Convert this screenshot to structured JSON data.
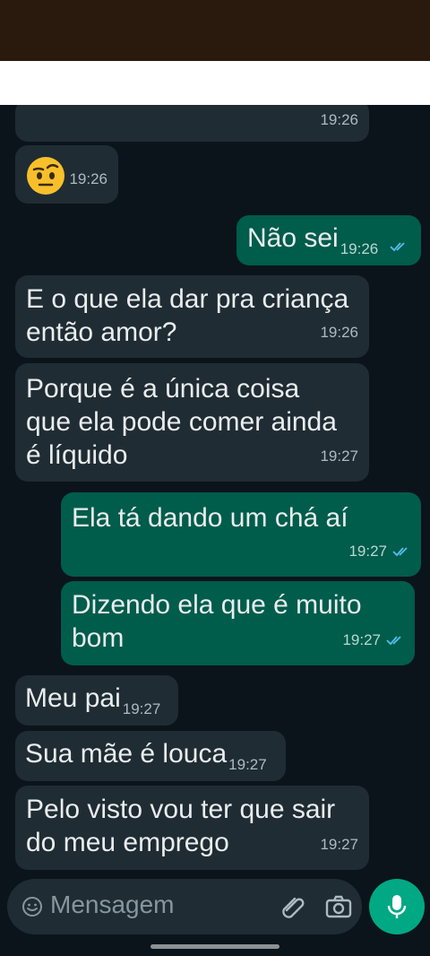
{
  "messages": [
    {
      "direction": "in",
      "text": "",
      "time": "19:26"
    },
    {
      "direction": "in",
      "emoji": "face-with-raised-eyebrow",
      "time": "19:26"
    },
    {
      "direction": "out",
      "text": "Não sei",
      "time": "19:26",
      "status": "read"
    },
    {
      "direction": "in",
      "lines": [
        "E o que ela dar pra criança",
        "então amor?"
      ],
      "time": "19:26"
    },
    {
      "direction": "in",
      "lines": [
        "Porque é a única coisa",
        "que ela pode comer ainda",
        "é líquido"
      ],
      "time": "19:27"
    },
    {
      "direction": "out",
      "text": "Ela tá dando um chá aí",
      "time": "19:27",
      "status": "read"
    },
    {
      "direction": "out",
      "lines": [
        "Dizendo ela que é muito",
        "bom"
      ],
      "time": "19:27",
      "status": "read"
    },
    {
      "direction": "in",
      "text": "Meu pai",
      "time": "19:27"
    },
    {
      "direction": "in",
      "text": "Sua mãe é louca",
      "time": "19:27"
    },
    {
      "direction": "in",
      "lines": [
        "Pelo visto vou ter que sair",
        "do meu emprego"
      ],
      "time": "19:27"
    }
  ],
  "composer": {
    "placeholder": "Mensagem",
    "icons": [
      "emoji-icon",
      "attach-icon",
      "camera-icon",
      "mic-icon"
    ]
  },
  "colors": {
    "background": "#0b141a",
    "incoming_bubble": "#202c33",
    "outgoing_bubble": "#005c4b",
    "accent": "#00a884",
    "read_tick": "#53bdeb"
  }
}
